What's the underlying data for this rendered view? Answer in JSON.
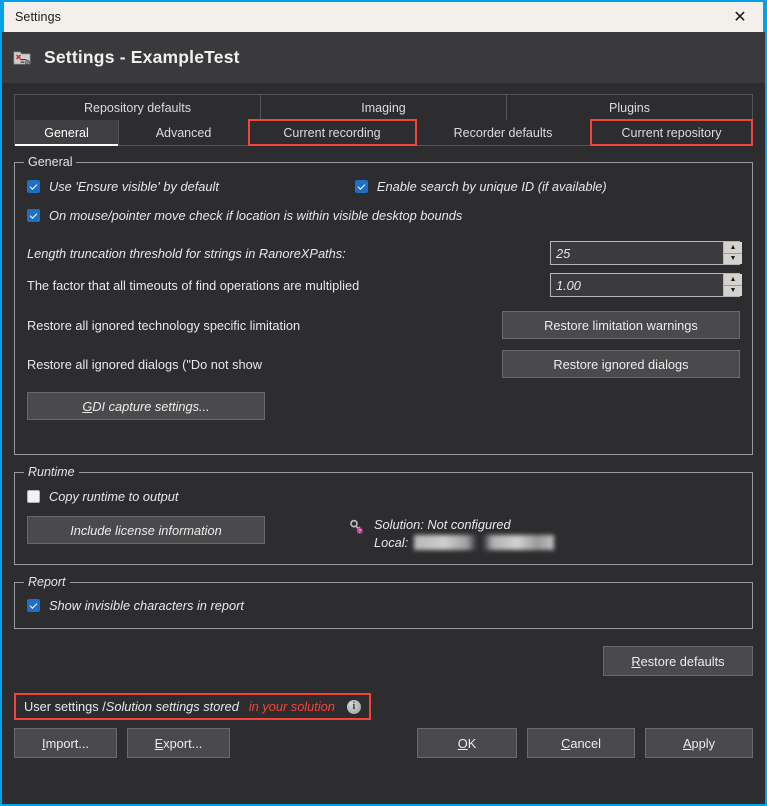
{
  "window": {
    "titlebar_text": "Settings",
    "close_label": "✕",
    "accent_border": "#00a2e8",
    "titlebar_bg": "#f3f0eb",
    "body_bg": "#2d2d30",
    "highlight_color": "#f4443a",
    "checkbox_color": "#1f6fc4"
  },
  "header": {
    "title": "Settings - ExampleTest",
    "icon": "settings-folder-icon"
  },
  "tabs": {
    "row1": [
      {
        "label": "Repository defaults",
        "active": false,
        "highlighted": false
      },
      {
        "label": "Imaging",
        "active": false,
        "highlighted": false
      },
      {
        "label": "Plugins",
        "active": false,
        "highlighted": false
      }
    ],
    "row2": [
      {
        "label": "General",
        "active": true,
        "highlighted": false
      },
      {
        "label": "Advanced",
        "active": false,
        "highlighted": false
      },
      {
        "label": "Current recording",
        "active": false,
        "highlighted": true
      },
      {
        "label": "Recorder defaults",
        "active": false,
        "highlighted": false
      },
      {
        "label": "Current repository",
        "active": false,
        "highlighted": true
      }
    ]
  },
  "general_group": {
    "legend": "General",
    "checkbox_ensure_visible": {
      "label": "Use 'Ensure visible' by default",
      "checked": true
    },
    "checkbox_unique_id": {
      "label": "Enable search by unique ID (if available)",
      "checked": true
    },
    "checkbox_desktop_bounds": {
      "label": "On mouse/pointer move check if location is within visible desktop bounds",
      "checked": true
    },
    "truncation": {
      "label": "Length truncation threshold for strings in RanoreXPaths:",
      "value": "25"
    },
    "timeout_factor": {
      "label": "The factor that all timeouts of find operations are multiplied",
      "value": "1.00"
    },
    "limitation": {
      "label": "Restore all ignored technology specific limitation",
      "button": "Restore limitation warnings"
    },
    "dialogs": {
      "label": "Restore all ignored dialogs (\"Do not show",
      "button": "Restore ignored dialogs"
    },
    "gdi_button": {
      "accel": "G",
      "rest": "DI capture settings..."
    }
  },
  "runtime_group": {
    "legend": "Runtime",
    "checkbox_copy_runtime": {
      "label": "Copy runtime to output",
      "checked": false
    },
    "license_button": "Include license information",
    "key_icon": "license-key-icon",
    "solution_line": "Solution: Not configured",
    "local_label": "Local:",
    "local_value": ""
  },
  "report_group": {
    "legend": "Report",
    "checkbox_invisible_chars": {
      "label": "Show invisible characters in report",
      "checked": true
    }
  },
  "restore_defaults_button": {
    "accel": "R",
    "rest": "estore defaults"
  },
  "status_bar": {
    "part1": "User settings / ",
    "part2": "Solution settings stored",
    "part3": "in your solution",
    "info_icon": "info-icon",
    "info_glyph": "i"
  },
  "footer_buttons": {
    "import": {
      "accel": "I",
      "rest": "mport..."
    },
    "export": {
      "accel": "E",
      "rest": "xport..."
    },
    "ok": {
      "accel": "O",
      "rest": "K"
    },
    "cancel": {
      "accel": "C",
      "rest": "ancel"
    },
    "apply": {
      "accel": "A",
      "rest": "pply"
    }
  },
  "spinner_glyphs": {
    "up": "▲",
    "down": "▼"
  }
}
